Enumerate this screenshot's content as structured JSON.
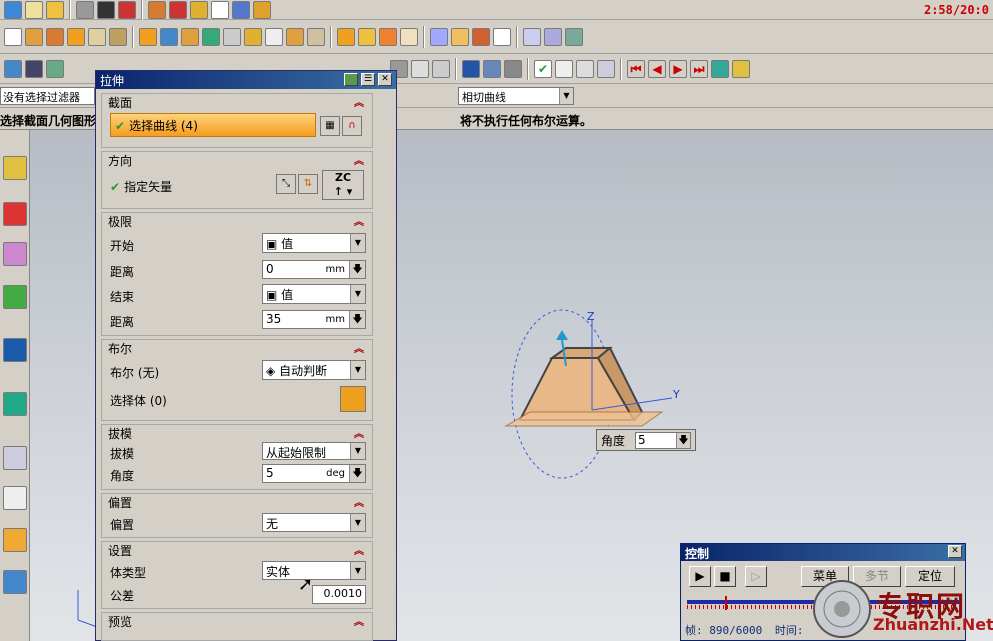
{
  "clock": "2:58/20:0",
  "selection_filter": "没有选择过滤器",
  "curve_rule": "相切曲线",
  "cue_left": "选择截面几何图形",
  "cue_right": "将不执行任何布尔运算。",
  "dialog": {
    "title": "拉伸",
    "section": {
      "label": "截面",
      "select_curve": "选择曲线 (4)"
    },
    "direction": {
      "label": "方向",
      "specify_vector": "指定矢量",
      "zc": "ZC"
    },
    "limits": {
      "label": "极限",
      "start_label": "开始",
      "start_value": "值",
      "distance1_label": "距离",
      "distance1_value": "0",
      "distance1_unit": "mm",
      "end_label": "结束",
      "end_value": "值",
      "distance2_label": "距离",
      "distance2_value": "35",
      "distance2_unit": "mm"
    },
    "boolean": {
      "label": "布尔",
      "bool_label": "布尔 (无)",
      "bool_value": "自动判断",
      "select_body": "选择体 (0)"
    },
    "draft": {
      "label": "拔模",
      "draft_label": "拔模",
      "draft_value": "从起始限制",
      "angle_label": "角度",
      "angle_value": "5",
      "angle_unit": "deg"
    },
    "offset": {
      "label": "偏置",
      "offset_label": "偏置",
      "offset_value": "无"
    },
    "settings": {
      "label": "设置",
      "body_type_label": "体类型",
      "body_type_value": "实体",
      "tolerance_label": "公差",
      "tolerance_value": "0.0010"
    },
    "preview": {
      "label": "预览"
    }
  },
  "angle_popup": {
    "label": "角度",
    "value": "5"
  },
  "axes": {
    "z": "Z",
    "y": "Y"
  },
  "control": {
    "title": "控制",
    "menu": "菜单",
    "segment": "多节",
    "locate": "定位",
    "progress": 0.14,
    "frame_label": "帧:",
    "frame_value": "890/6000",
    "time_label": "时间:"
  },
  "watermark": {
    "cn": "专职网",
    "url": "Zhuanzhi.Net"
  }
}
